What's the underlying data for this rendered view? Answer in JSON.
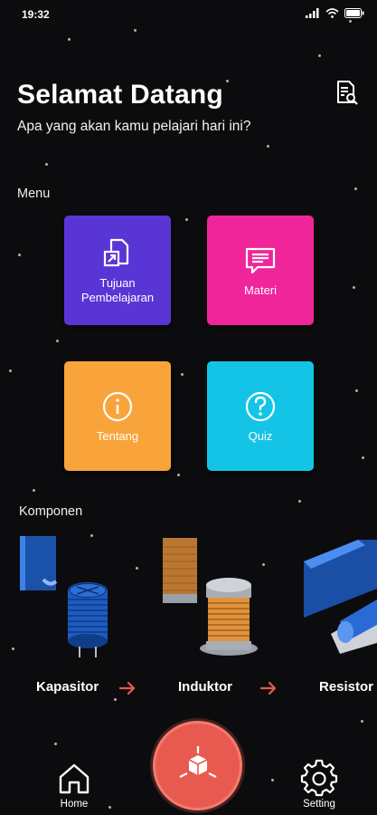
{
  "status": {
    "time": "19:32"
  },
  "header": {
    "title": "Selamat Datang",
    "subtitle": "Apa yang akan kamu pelajari hari ini?"
  },
  "menu": {
    "label": "Menu",
    "items": [
      {
        "label": "Tujuan Pembelajaran",
        "color": "#5a35d6",
        "icon": "document-export-icon"
      },
      {
        "label": "Materi",
        "color": "#f0259a",
        "icon": "message-icon"
      },
      {
        "label": "Tentang",
        "color": "#f9a43a",
        "icon": "info-icon"
      },
      {
        "label": "Quiz",
        "color": "#14c4e6",
        "icon": "question-icon"
      }
    ]
  },
  "components": {
    "label": "Komponen",
    "items": [
      {
        "label": "Kapasitor"
      },
      {
        "label": "Induktor"
      },
      {
        "label": "Resistor"
      }
    ]
  },
  "nav": {
    "home_label": "Home",
    "setting_label": "Setting"
  },
  "colors": {
    "accent": "#e85a4f",
    "background": "#0c0c0e"
  }
}
